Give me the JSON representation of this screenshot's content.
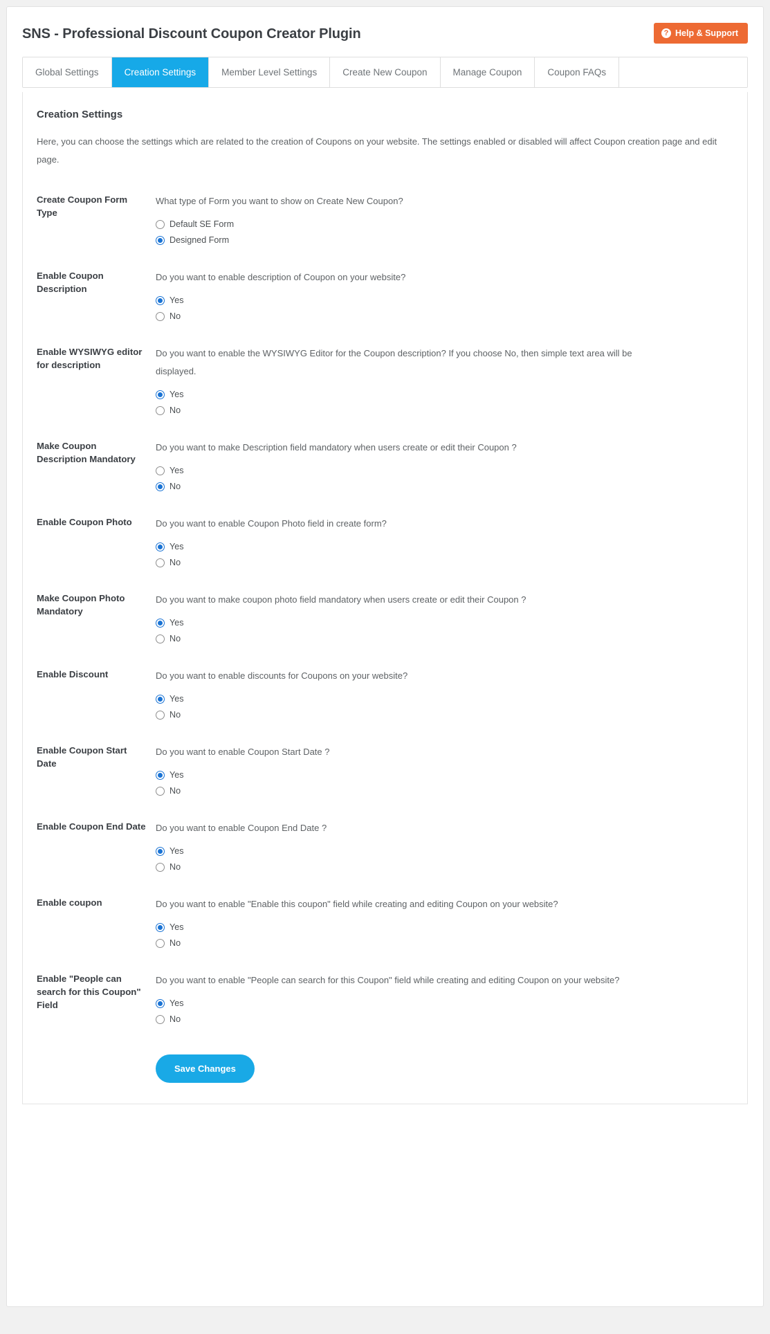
{
  "header": {
    "title": "SNS - Professional Discount Coupon Creator Plugin",
    "help_button_label": "Help & Support",
    "help_icon_glyph": "?",
    "help_button_color": "#ed6a33"
  },
  "tabs": [
    {
      "label": "Global Settings",
      "active": false
    },
    {
      "label": "Creation Settings",
      "active": true
    },
    {
      "label": "Member Level Settings",
      "active": false
    },
    {
      "label": "Create New Coupon",
      "active": false
    },
    {
      "label": "Manage Coupon",
      "active": false
    },
    {
      "label": "Coupon FAQs",
      "active": false
    }
  ],
  "active_tab_color": "#16a9e8",
  "panel": {
    "title": "Creation Settings",
    "description": "Here, you can choose the settings which are related to the creation of Coupons on your website. The settings enabled or disabled will affect Coupon creation page and edit page."
  },
  "settings": [
    {
      "label": "Create Coupon Form Type",
      "question": "What type of Form you want to show on Create New Coupon?",
      "options": [
        {
          "label": "Default SE Form",
          "checked": false
        },
        {
          "label": "Designed Form",
          "checked": true
        }
      ]
    },
    {
      "label": "Enable Coupon Description",
      "question": "Do you want to enable description of Coupon on your website?",
      "options": [
        {
          "label": "Yes",
          "checked": true
        },
        {
          "label": "No",
          "checked": false
        }
      ]
    },
    {
      "label": "Enable WYSIWYG editor for description",
      "question": "Do you want to enable the WYSIWYG Editor for the Coupon description? If you choose No, then simple text area will be displayed.",
      "options": [
        {
          "label": "Yes",
          "checked": true
        },
        {
          "label": "No",
          "checked": false
        }
      ]
    },
    {
      "label": "Make Coupon Description Mandatory",
      "question": "Do you want to make Description field mandatory when users create or edit their Coupon ?",
      "options": [
        {
          "label": "Yes",
          "checked": false
        },
        {
          "label": "No",
          "checked": true
        }
      ]
    },
    {
      "label": "Enable Coupon Photo",
      "question": "Do you want to enable Coupon Photo field in create form?",
      "options": [
        {
          "label": "Yes",
          "checked": true
        },
        {
          "label": "No",
          "checked": false
        }
      ]
    },
    {
      "label": "Make Coupon Photo Mandatory",
      "question": "Do you want to make coupon photo field mandatory when users create or edit their Coupon ?",
      "options": [
        {
          "label": "Yes",
          "checked": true
        },
        {
          "label": "No",
          "checked": false
        }
      ]
    },
    {
      "label": "Enable Discount",
      "question": "Do you want to enable discounts for Coupons on your website?",
      "options": [
        {
          "label": "Yes",
          "checked": true
        },
        {
          "label": "No",
          "checked": false
        }
      ]
    },
    {
      "label": "Enable Coupon Start Date",
      "question": "Do you want to enable Coupon Start Date ?",
      "options": [
        {
          "label": "Yes",
          "checked": true
        },
        {
          "label": "No",
          "checked": false
        }
      ]
    },
    {
      "label": "Enable Coupon End Date",
      "question": "Do you want to enable Coupon End Date ?",
      "options": [
        {
          "label": "Yes",
          "checked": true
        },
        {
          "label": "No",
          "checked": false
        }
      ]
    },
    {
      "label": "Enable coupon",
      "question": "Do you want to enable \"Enable this coupon\" field while creating and editing Coupon on your website?",
      "options": [
        {
          "label": "Yes",
          "checked": true
        },
        {
          "label": "No",
          "checked": false
        }
      ]
    },
    {
      "label": "Enable \"People can search for this Coupon\" Field",
      "question": "Do you want to enable \"People can search for this Coupon\" field while creating and editing Coupon on your website?",
      "options": [
        {
          "label": "Yes",
          "checked": true
        },
        {
          "label": "No",
          "checked": false
        }
      ]
    }
  ],
  "save_button": {
    "label": "Save Changes",
    "color": "#19a9e6"
  }
}
